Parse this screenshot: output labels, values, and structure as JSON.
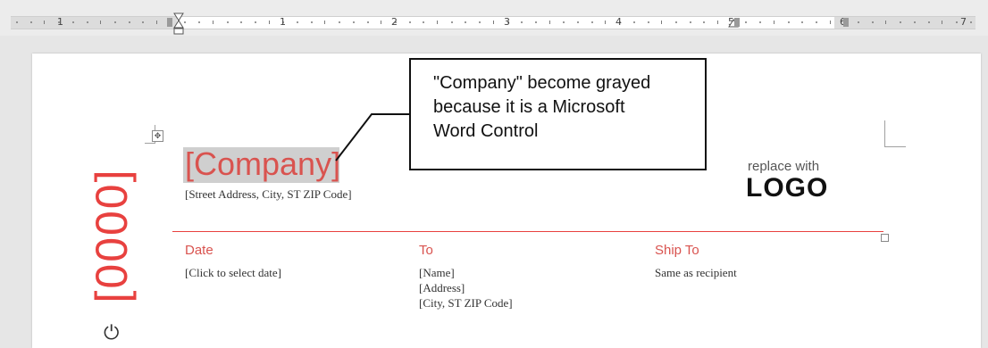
{
  "ruler": {
    "numbers": [
      "1",
      "1",
      "2",
      "3",
      "4",
      "5",
      "6",
      "7"
    ]
  },
  "document": {
    "vertical_number": "[0000]",
    "company": "[Company]",
    "street_address": "[Street Address, City, ST ZIP Code]",
    "logo": {
      "small": "replace with",
      "big": "LOGO"
    },
    "columns": {
      "date": {
        "title": "Date",
        "value": "[Click to select date]"
      },
      "to": {
        "title": "To",
        "lines": [
          "[Name]",
          "[Address]",
          "[City, ST  ZIP Code]"
        ]
      },
      "ship_to": {
        "title": "Ship To",
        "value": "Same as recipient"
      }
    }
  },
  "callout": {
    "lines": [
      "\"Company\" become grayed",
      "because it is a Microsoft",
      "Word Control"
    ]
  },
  "icons": {
    "table_move_handle": "move-arrows-icon",
    "partial_glyph": "power-icon"
  },
  "colors": {
    "accent_red": "#e8413f",
    "company_red": "#d9534f",
    "highlight_gray": "#cfcfcf"
  }
}
